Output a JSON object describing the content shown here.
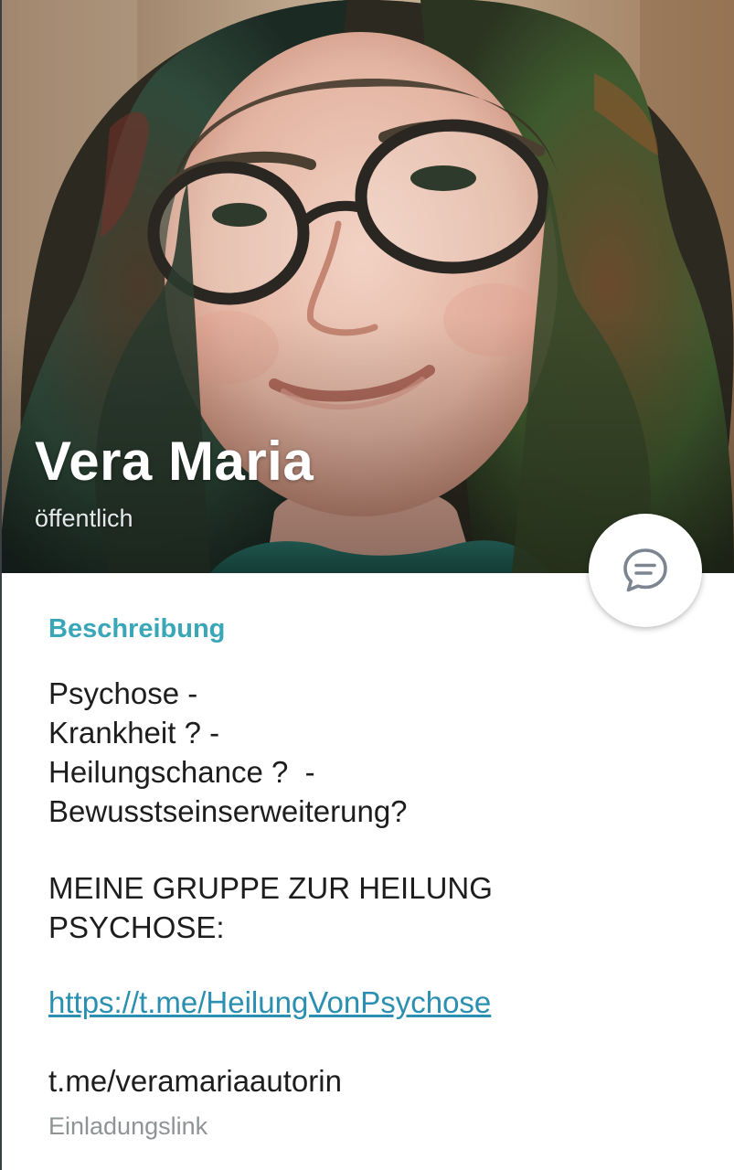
{
  "profile": {
    "name": "Vera Maria",
    "status": "öffentlich"
  },
  "description": {
    "title": "Beschreibung",
    "lines": [
      "Psychose -",
      "Krankheit ? -",
      "Heilungschance ?  -",
      "Bewusstseinserweiterung?",
      "MEINE GRUPPE ZUR HEILUNG",
      "PSYCHOSE:"
    ],
    "link": "https://t.me/HeilungVonPsychose"
  },
  "username": {
    "value": "t.me/veramariaautorin",
    "caption": "Einladungslink"
  },
  "icons": {
    "chat_button": "chat-bubble-icon"
  },
  "colors": {
    "accent": "#3aa7b8",
    "link": "#2a8fb0",
    "text": "#1d1d1d",
    "secondary_text": "#8e9396"
  }
}
